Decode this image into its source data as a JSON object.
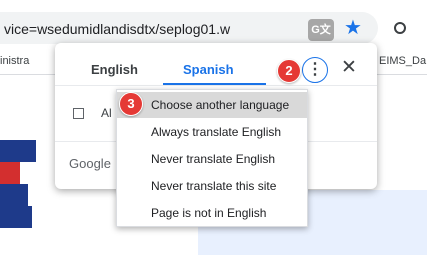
{
  "address_bar": {
    "url_text": "vice=wsedumidlandisdtx/seplog01.w",
    "translate_icon": "translate-icon",
    "star_icon": "star-icon"
  },
  "bookmarks_bar": {
    "left_item": "inistra",
    "right_item": "EIMS_Da"
  },
  "translate_popup": {
    "tabs": [
      {
        "label": "English",
        "selected": false
      },
      {
        "label": "Spanish",
        "selected": true
      }
    ],
    "more_icon": "more-vert-icon",
    "close_icon": "close-icon",
    "always_label": "Al",
    "footer_label": "Google"
  },
  "options_menu": {
    "items": [
      {
        "label": "Choose another language",
        "highlighted": true
      },
      {
        "label": "Always translate English",
        "highlighted": false
      },
      {
        "label": "Never translate English",
        "highlighted": false
      },
      {
        "label": "Never translate this site",
        "highlighted": false
      },
      {
        "label": "Page is not in English",
        "highlighted": false
      }
    ]
  },
  "step_badges": [
    {
      "number": "2"
    },
    {
      "number": "3"
    }
  ],
  "colors": {
    "accent": "#1a73e8",
    "badge": "#e53935",
    "logo_blue": "#1e3a8a",
    "logo_red": "#d32f2f"
  }
}
